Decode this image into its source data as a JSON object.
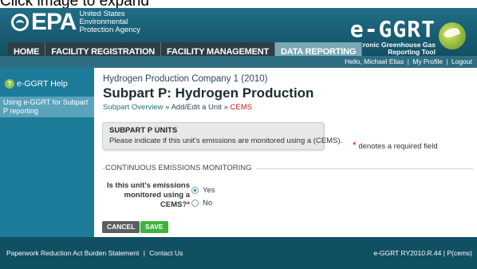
{
  "caption": "Click image to expand",
  "header": {
    "agency_logo": "EPA",
    "agency_name": "United States Environmental Protection Agency",
    "brand_name": "e-GGRT",
    "brand_sub": "Electronic Greenhouse Gas Reporting Tool"
  },
  "nav": {
    "tabs": [
      {
        "label": "HOME"
      },
      {
        "label": "FACILITY REGISTRATION"
      },
      {
        "label": "FACILITY MANAGEMENT"
      },
      {
        "label": "DATA REPORTING"
      }
    ]
  },
  "userbar": {
    "greeting": "Hello, Michael Elias",
    "profile": "My Profile",
    "logout": "Logout"
  },
  "sidebar": {
    "help_label": "e-GGRT Help",
    "link_label": "Using e-GGRT for Subpart P reporting"
  },
  "main": {
    "company": "Hydrogen Production Company 1 (2010)",
    "title": "Subpart P: Hydrogen Production",
    "breadcrumb": {
      "overview": "Subpart Overview",
      "sep1": "»",
      "add_edit": "Add/Edit a Unit",
      "sep2": "»",
      "current": "CEMS"
    },
    "units_box": {
      "title": "SUBPART P UNITS",
      "text": "Please indicate if this unit's emissions are monitored using a (CEMS)."
    },
    "required_note": "denotes a required field",
    "section_title": "CONTINUOUS EMISSIONS MONITORING",
    "question": "Is this unit's emissions monitored using a CEMS?",
    "options": [
      {
        "label": "Yes",
        "checked": true
      },
      {
        "label": "No",
        "checked": false
      }
    ],
    "cancel_label": "CANCEL",
    "save_label": "SAVE"
  },
  "footer": {
    "paperwork": "Paperwork Reduction Act Burden Statement",
    "contact": "Contact Us",
    "version": "e-GGRT RY2010.R.44",
    "page_code": "P(cems)"
  }
}
